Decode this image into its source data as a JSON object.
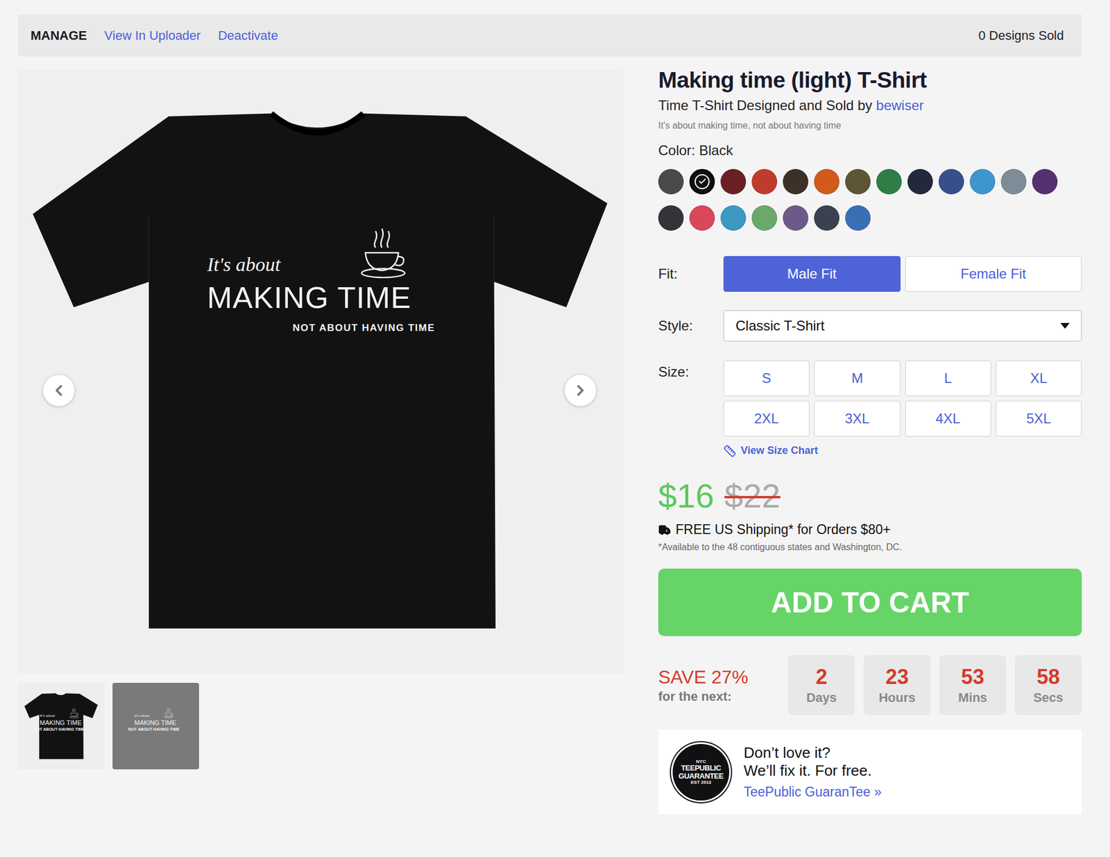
{
  "topbar": {
    "title": "MANAGE",
    "links": [
      "View In Uploader",
      "Deactivate"
    ],
    "designs_sold": "0 Designs Sold"
  },
  "gallery": {
    "design": {
      "line1": "It's about",
      "line2": "MAKING TIME",
      "line3": "NOT ABOUT HAVING TIME"
    },
    "thumbnails": [
      {
        "kind": "shirt"
      },
      {
        "kind": "art"
      }
    ]
  },
  "product": {
    "title": "Making time (light) T-Shirt",
    "byline": "Time T-Shirt Designed and Sold by",
    "designer": "bewiser",
    "description": "It's about making time, not about having time"
  },
  "color": {
    "label": "Color: Black",
    "swatches": [
      {
        "color": "#4a4a4c",
        "selected": false
      },
      {
        "color": "#111111",
        "selected": true
      },
      {
        "color": "#6b1f24",
        "selected": false
      },
      {
        "color": "#c13a2e",
        "selected": false
      },
      {
        "color": "#3d3029",
        "selected": false
      },
      {
        "color": "#d35a1c",
        "selected": false
      },
      {
        "color": "#5c5636",
        "selected": false
      },
      {
        "color": "#2f7d47",
        "selected": false
      },
      {
        "color": "#23283a",
        "selected": false
      },
      {
        "color": "#36508c",
        "selected": false
      },
      {
        "color": "#3d96cc",
        "selected": false
      },
      {
        "color": "#7d8c97",
        "selected": false
      },
      {
        "color": "#553070",
        "selected": false
      },
      {
        "color": "#333438",
        "selected": false
      },
      {
        "color": "#d9475a",
        "selected": false
      },
      {
        "color": "#3b99c2",
        "selected": false
      },
      {
        "color": "#6aa86b",
        "selected": false
      },
      {
        "color": "#6e5a8a",
        "selected": false
      },
      {
        "color": "#3a4150",
        "selected": false
      },
      {
        "color": "#3a6fb5",
        "selected": false
      }
    ]
  },
  "fit": {
    "label": "Fit:",
    "options": [
      {
        "label": "Male Fit",
        "selected": true
      },
      {
        "label": "Female Fit",
        "selected": false
      }
    ]
  },
  "style": {
    "label": "Style:",
    "value": "Classic T-Shirt"
  },
  "size": {
    "label": "Size:",
    "options": [
      {
        "label": "S",
        "selected": false
      },
      {
        "label": "M",
        "selected": false
      },
      {
        "label": "L",
        "selected": false
      },
      {
        "label": "XL",
        "selected": false
      },
      {
        "label": "2XL",
        "selected": false
      },
      {
        "label": "3XL",
        "selected": false
      },
      {
        "label": "4XL",
        "selected": false
      },
      {
        "label": "5XL",
        "selected": false
      }
    ],
    "chart_link": "View Size Chart"
  },
  "price": {
    "current": "$16",
    "original": "$22"
  },
  "shipping": {
    "text": "FREE US Shipping* for Orders $80+",
    "note": "*Available to the 48 contiguous states and Washington, DC."
  },
  "cart_button": "ADD TO CART",
  "sale": {
    "headline": "SAVE 27%",
    "subline": "for the next:",
    "countdown": [
      {
        "value": "2",
        "unit": "Days"
      },
      {
        "value": "23",
        "unit": "Hours"
      },
      {
        "value": "53",
        "unit": "Mins"
      },
      {
        "value": "58",
        "unit": "Secs"
      }
    ]
  },
  "guarantee": {
    "badge": [
      "NYC",
      "TEEPUBLIC",
      "GUARANTEE",
      "EST 2013"
    ],
    "line1": "Don’t love it?",
    "line2": "We’ll fix it. For free.",
    "link": "TeePublic GuaranTee »"
  }
}
